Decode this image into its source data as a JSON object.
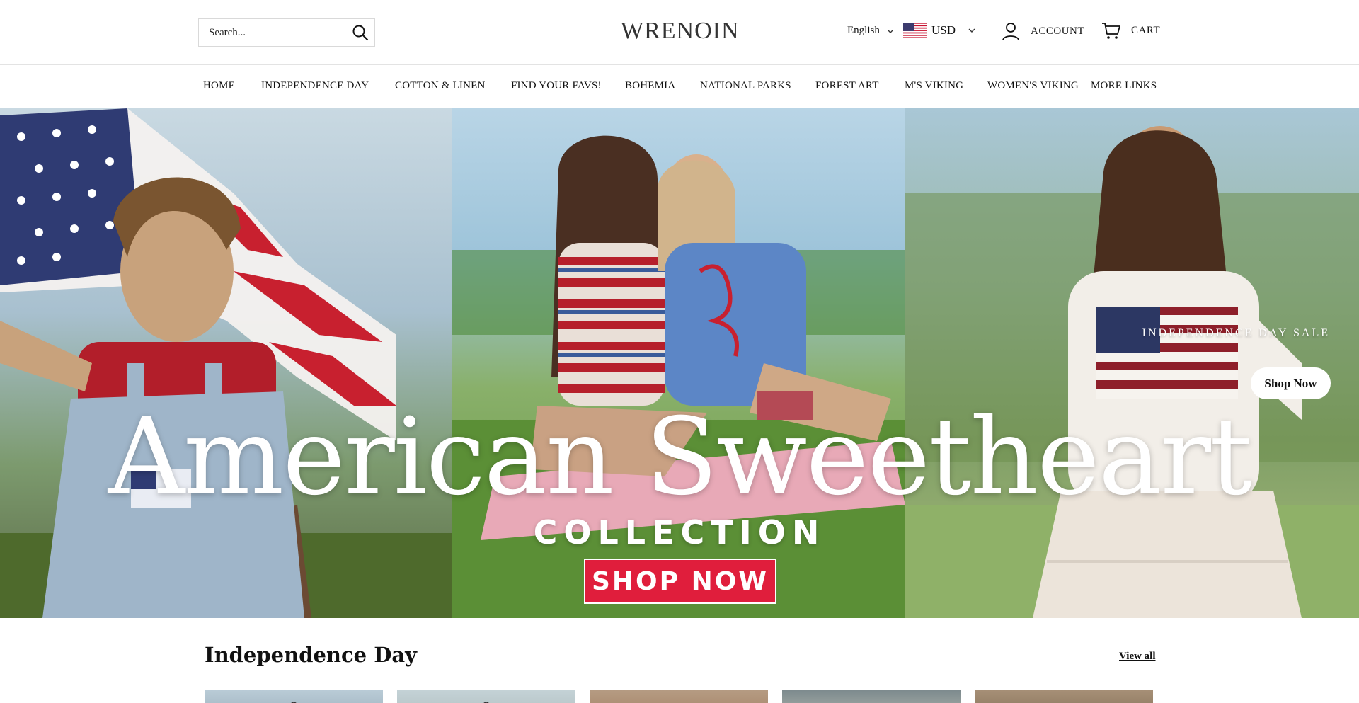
{
  "header": {
    "search": {
      "placeholder": "Search..."
    },
    "logo": "WRENOIN",
    "language": "English",
    "currency": "USD",
    "account_label": "ACCOUNT",
    "cart_label": "CART"
  },
  "nav": {
    "items": [
      "HOME",
      "INDEPENDENCE DAY",
      "COTTON & LINEN",
      "FIND YOUR FAVS!",
      "BOHEMIA",
      "NATIONAL PARKS",
      "FOREST ART",
      "M'S VIKING",
      "WOMEN'S VIKING",
      "MORE LINKS"
    ]
  },
  "hero": {
    "heading": "American Sweetheart",
    "subheading": "COLLECTION",
    "cta": "SHOP NOW",
    "sale_label": "INDEPENDENCE DAY SALE",
    "shop_now": "Shop Now"
  },
  "section": {
    "title": "Independence Day",
    "view_all": "View all"
  },
  "colors": {
    "accent_red": "#e01e3c",
    "text": "#111111",
    "border": "#e3e3e3"
  }
}
